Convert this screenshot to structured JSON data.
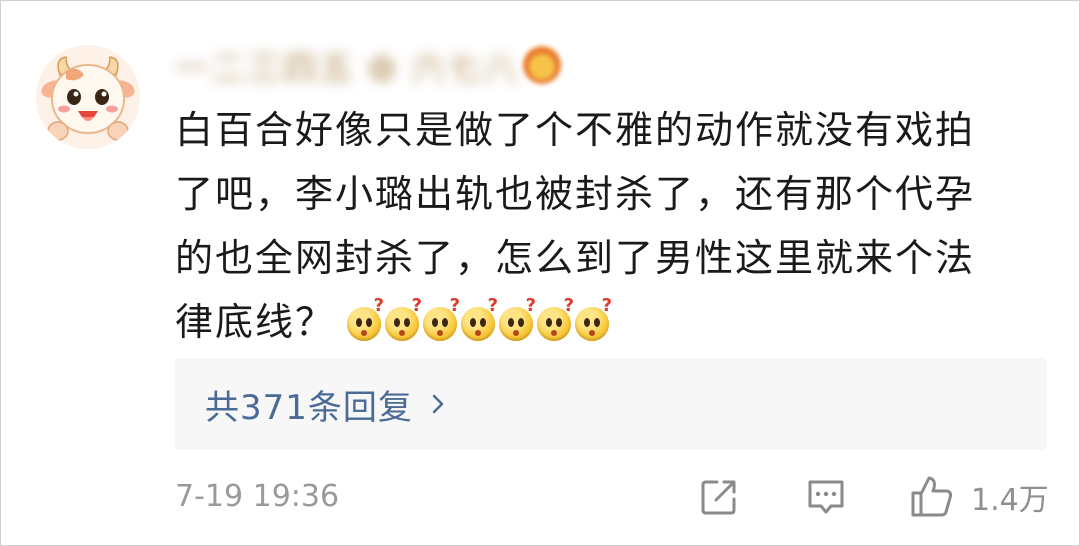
{
  "comment": {
    "username": "一二三四五 ✿ 六七八",
    "body_lines": [
      "白百合好像只是做了个不雅的动作就没有戏拍",
      "了吧，李小璐出轨也被封杀了，还有那个代孕",
      "的也全网封杀了，怎么到了男性这里就来个法",
      "律底线？"
    ],
    "emoji_count": 7,
    "emoji_name": "thinking-question-emoji",
    "replies_label": "共371条回复",
    "timestamp": "7-19 19:36",
    "like_count": "1.4万"
  },
  "icons": {
    "avatar": "cartoon-cow-avatar",
    "replies_chevron": "chevron-right-icon",
    "share": "share-icon",
    "comment": "comment-icon",
    "like": "thumbs-up-icon"
  },
  "colors": {
    "body_text": "#1a1a1a",
    "link": "#4b6b97",
    "meta": "#9a9a9a",
    "reply_bg": "#f7f7f7"
  }
}
